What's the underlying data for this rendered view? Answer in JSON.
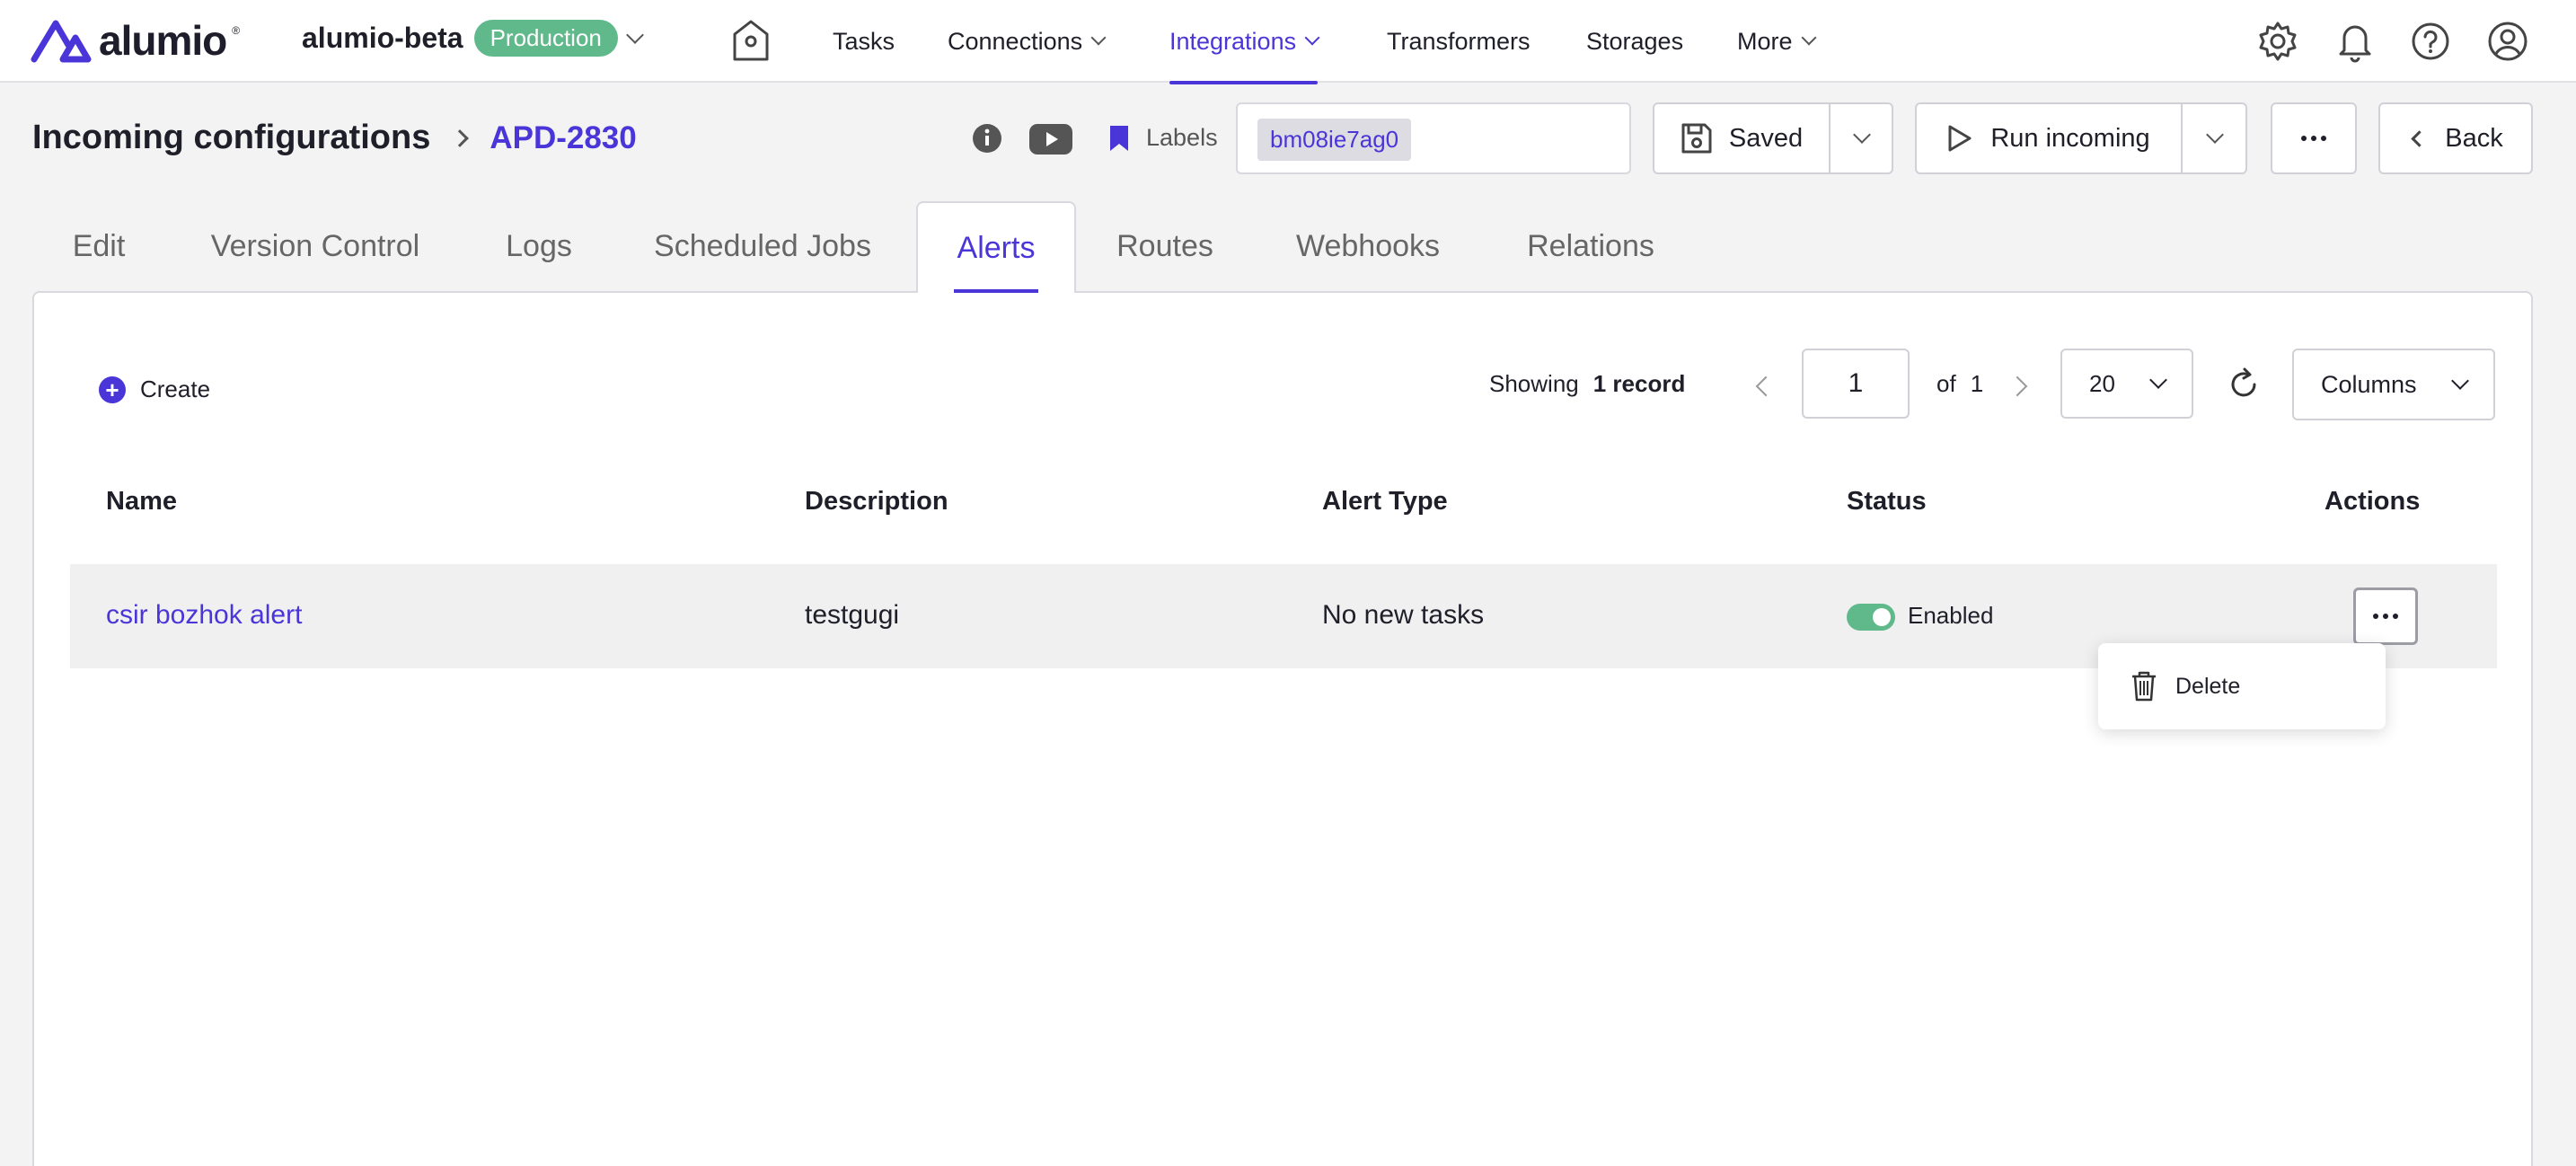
{
  "topbar": {
    "logo": "alumio",
    "environment": "alumio-beta",
    "environment_badge": "Production",
    "nav": [
      {
        "label": "Tasks"
      },
      {
        "label": "Connections"
      },
      {
        "label": "Integrations"
      },
      {
        "label": "Transformers"
      },
      {
        "label": "Storages"
      },
      {
        "label": "More"
      }
    ]
  },
  "header": {
    "breadcrumb_root": "Incoming configurations",
    "breadcrumb_current": "APD-2830",
    "labels_text": "Labels",
    "label_chip": "bm08ie7ag0",
    "saved_label": "Saved",
    "run_label": "Run incoming",
    "back_label": "Back"
  },
  "tabs": [
    {
      "label": "Edit"
    },
    {
      "label": "Version Control"
    },
    {
      "label": "Logs"
    },
    {
      "label": "Scheduled Jobs"
    },
    {
      "label": "Alerts"
    },
    {
      "label": "Routes"
    },
    {
      "label": "Webhooks"
    },
    {
      "label": "Relations"
    }
  ],
  "toolbar": {
    "create_label": "Create",
    "showing_label": "Showing",
    "showing_count": "1 record",
    "page": "1",
    "of_label": "of",
    "total_pages": "1",
    "per_page": "20",
    "columns_label": "Columns"
  },
  "table": {
    "headers": [
      "Name",
      "Description",
      "Alert Type",
      "Status",
      "Actions"
    ],
    "rows": [
      {
        "name": "csir bozhok alert",
        "description": "testgugi",
        "alert_type": "No new tasks",
        "status": "Enabled"
      }
    ]
  },
  "actions_menu": {
    "delete_label": "Delete"
  },
  "colors": {
    "accent": "#4a36d8",
    "badge_green": "#5fb98a"
  }
}
